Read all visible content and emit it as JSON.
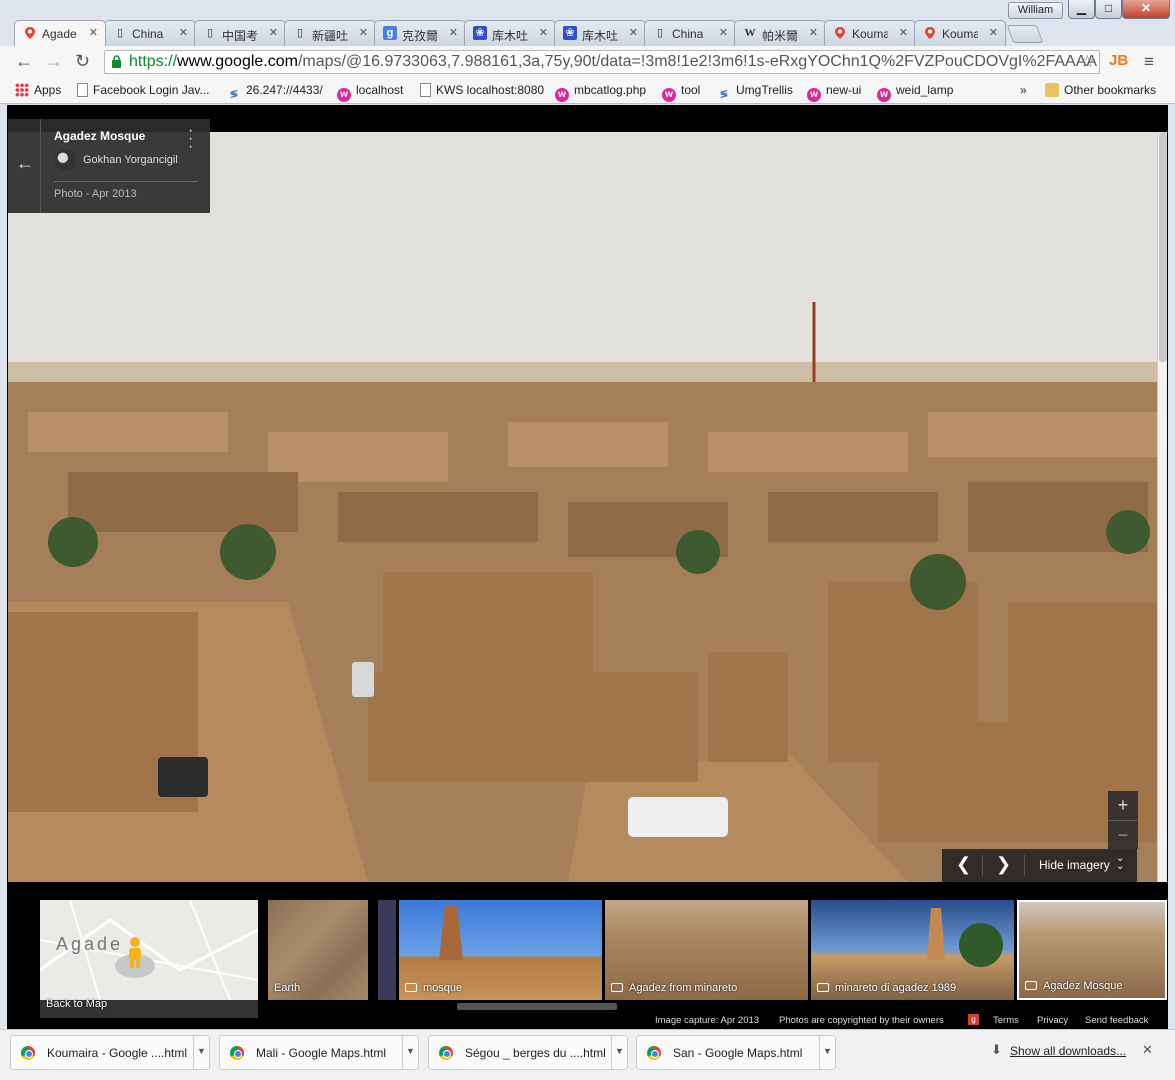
{
  "window": {
    "user": "William",
    "minimize_label": "▁",
    "maximize_label": "□",
    "close_label": "✕"
  },
  "tabs": [
    {
      "label": "Agade",
      "icon": "google-maps-icon",
      "active": true
    },
    {
      "label": "China",
      "icon": "page-icon"
    },
    {
      "label": "中国考",
      "icon": "page-icon"
    },
    {
      "label": "新疆吐",
      "icon": "page-icon"
    },
    {
      "label": "克孜爾",
      "icon": "google-g-icon"
    },
    {
      "label": "库木吐",
      "icon": "baidu-icon"
    },
    {
      "label": "库木吐",
      "icon": "baidu-icon"
    },
    {
      "label": "China",
      "icon": "page-icon"
    },
    {
      "label": "帕米爾",
      "icon": "wikipedia-icon"
    },
    {
      "label": "Kouma",
      "icon": "google-maps-icon"
    },
    {
      "label": "Kouma",
      "icon": "google-maps-icon"
    }
  ],
  "toolbar": {
    "url_proto": "https://",
    "url_host": "www.google.com",
    "url_path": "/maps/@16.9733063,7.988161,3a,75y,90t/data=!3m8!1e2!3m6!1s-eRxgYOChn1Q%2FVZPouCDOVgI%2FAAAA",
    "extension": "JB"
  },
  "bookmarks": [
    {
      "label": "Apps",
      "icon": "apps"
    },
    {
      "label": "Facebook Login Jav...",
      "icon": "page"
    },
    {
      "label": "26.247://4433/",
      "icon": "blue"
    },
    {
      "label": "localhost",
      "icon": "magenta"
    },
    {
      "label": "KWS localhost:8080",
      "icon": "page"
    },
    {
      "label": "mbcatlog.php",
      "icon": "magenta"
    },
    {
      "label": "tool",
      "icon": "magenta"
    },
    {
      "label": "UmgTrellis",
      "icon": "blue"
    },
    {
      "label": "new-ui",
      "icon": "magenta"
    },
    {
      "label": "weid_lamp",
      "icon": "magenta"
    }
  ],
  "bookmarks_overflow": "»",
  "other_bookmarks": "Other bookmarks",
  "card": {
    "title": "Agadez Mosque",
    "author": "Gokhan Yorgancigil",
    "date": "Photo - Apr 2013"
  },
  "zoom": {
    "in": "+",
    "out": "−"
  },
  "imagery_nav": {
    "prev": "❮",
    "next": "❯",
    "hide_label": "Hide imagery"
  },
  "filmstrip": {
    "map_thumb_text": "Agade",
    "back_to_map": "Back to Map",
    "earth": "Earth",
    "items": [
      "mosque",
      "Agadez from minareto",
      "minareto di agadez 1989",
      "Agadez Mosque"
    ]
  },
  "footer": {
    "capture": "Image capture: Apr 2013",
    "copyright": "Photos are copyrighted by their owners",
    "terms": "Terms",
    "privacy": "Privacy",
    "feedback": "Send feedback"
  },
  "downloads": [
    {
      "name": "Koumaira - Google ....html"
    },
    {
      "name": "Mali - Google Maps.html"
    },
    {
      "name": "Ségou _ berges du ....html"
    },
    {
      "name": "San - Google Maps.html"
    }
  ],
  "show_all_downloads": "Show all downloads...",
  "colors": {
    "accent_green": "#0a8a2a",
    "bookmark_magenta": "#e0279a",
    "ext_orange": "#e77b18"
  }
}
